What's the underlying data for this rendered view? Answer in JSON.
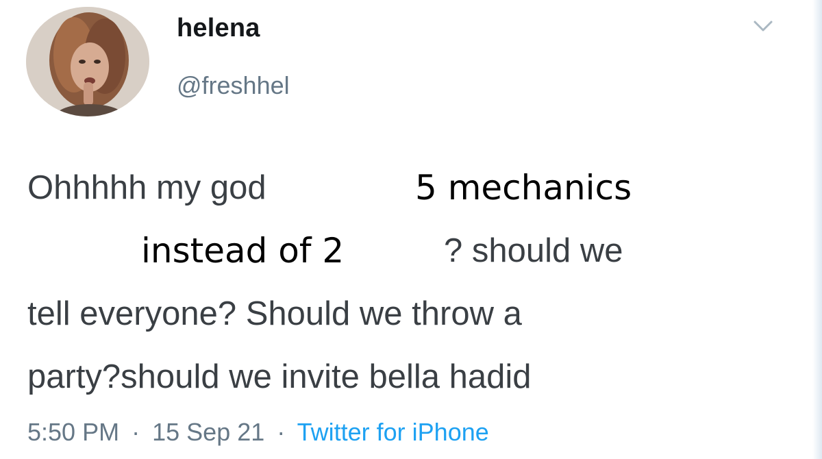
{
  "user": {
    "display_name": "helena",
    "handle": "@freshhel"
  },
  "tweet": {
    "line1": "Ohhhhh my god",
    "overlay1": "5 mechanics",
    "overlay2": "instead of 2",
    "line2_rest": "? should we",
    "line3": "tell everyone? Should we throw a",
    "line4": "party?should we invite bella hadid"
  },
  "meta": {
    "time": "5:50 PM",
    "date": "15 Sep 21",
    "separator": "·",
    "source": "Twitter for iPhone"
  },
  "icons": {
    "menu": "chevron-down-icon",
    "avatar": "avatar"
  },
  "colors": {
    "text": "#3a3f44",
    "secondary": "#657786",
    "link": "#1da1f2",
    "background": "#ffffff"
  }
}
